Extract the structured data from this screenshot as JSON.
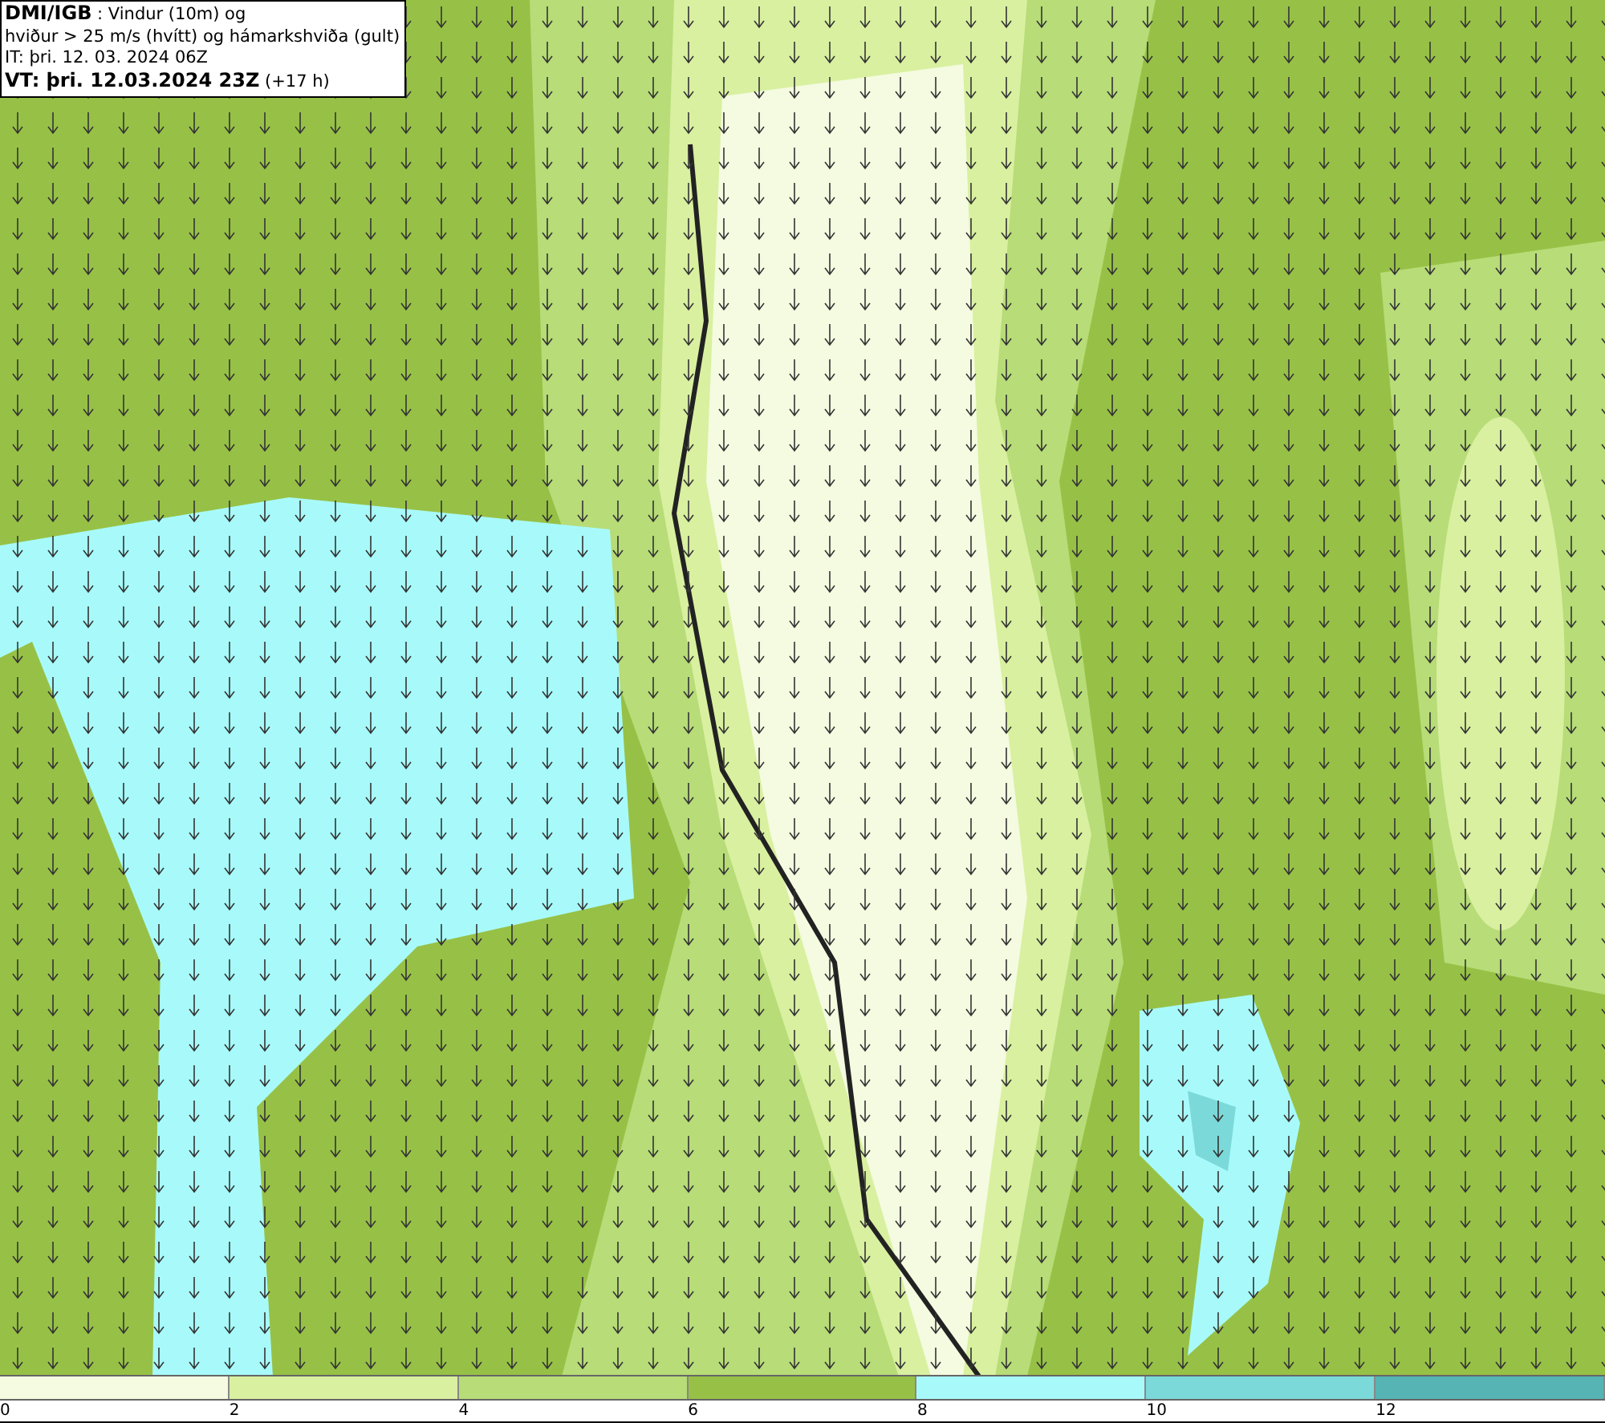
{
  "header": {
    "lines": [
      "**DMI/IGB** : Vindur (10m) og",
      "hviður > 25 m/s (hvítt) og hámarkshviða (gult)",
      "IT: þri. 12. 03. 2024 06Z",
      "**VT: þri. 12.03.2024 23Z** (+17 h)"
    ]
  },
  "legend": {
    "bins": [
      {
        "color": "#f4fbe0"
      },
      {
        "color": "#d9f0a0"
      },
      {
        "color": "#b7dc78"
      },
      {
        "color": "#97c146"
      },
      {
        "color": "#a8fafa"
      },
      {
        "color": "#7cd9d9"
      },
      {
        "color": "#56b4b4"
      }
    ],
    "ticks": [
      "0",
      "2",
      "4",
      "6",
      "8",
      "10",
      "12"
    ]
  }
}
